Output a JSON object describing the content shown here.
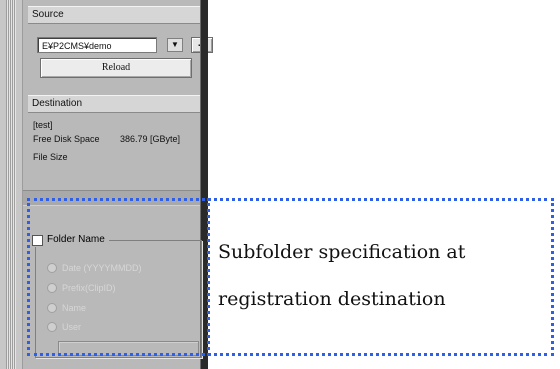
{
  "source": {
    "header": "Source",
    "path_value": "E¥P2CMS¥demo",
    "dropdown_arrow": "▼",
    "browse_label": "...",
    "reload_label": "Reload"
  },
  "destination": {
    "header": "Destination",
    "drive_label": "[test]",
    "free_disk_label": "Free Disk Space",
    "free_disk_value": "386.79 [GByte]",
    "file_size_label": "File Size"
  },
  "folder_name": {
    "title": "Folder Name",
    "checked": false,
    "options": [
      {
        "label": "Date (YYYYMMDD)"
      },
      {
        "label": "Prefix(ClipID)"
      },
      {
        "label": "Name"
      },
      {
        "label": "User"
      }
    ],
    "custom_value": ""
  },
  "annotation": {
    "line1": "Subfolder specification at",
    "line2": "registration destination",
    "border_color": "#2f5fe8"
  }
}
